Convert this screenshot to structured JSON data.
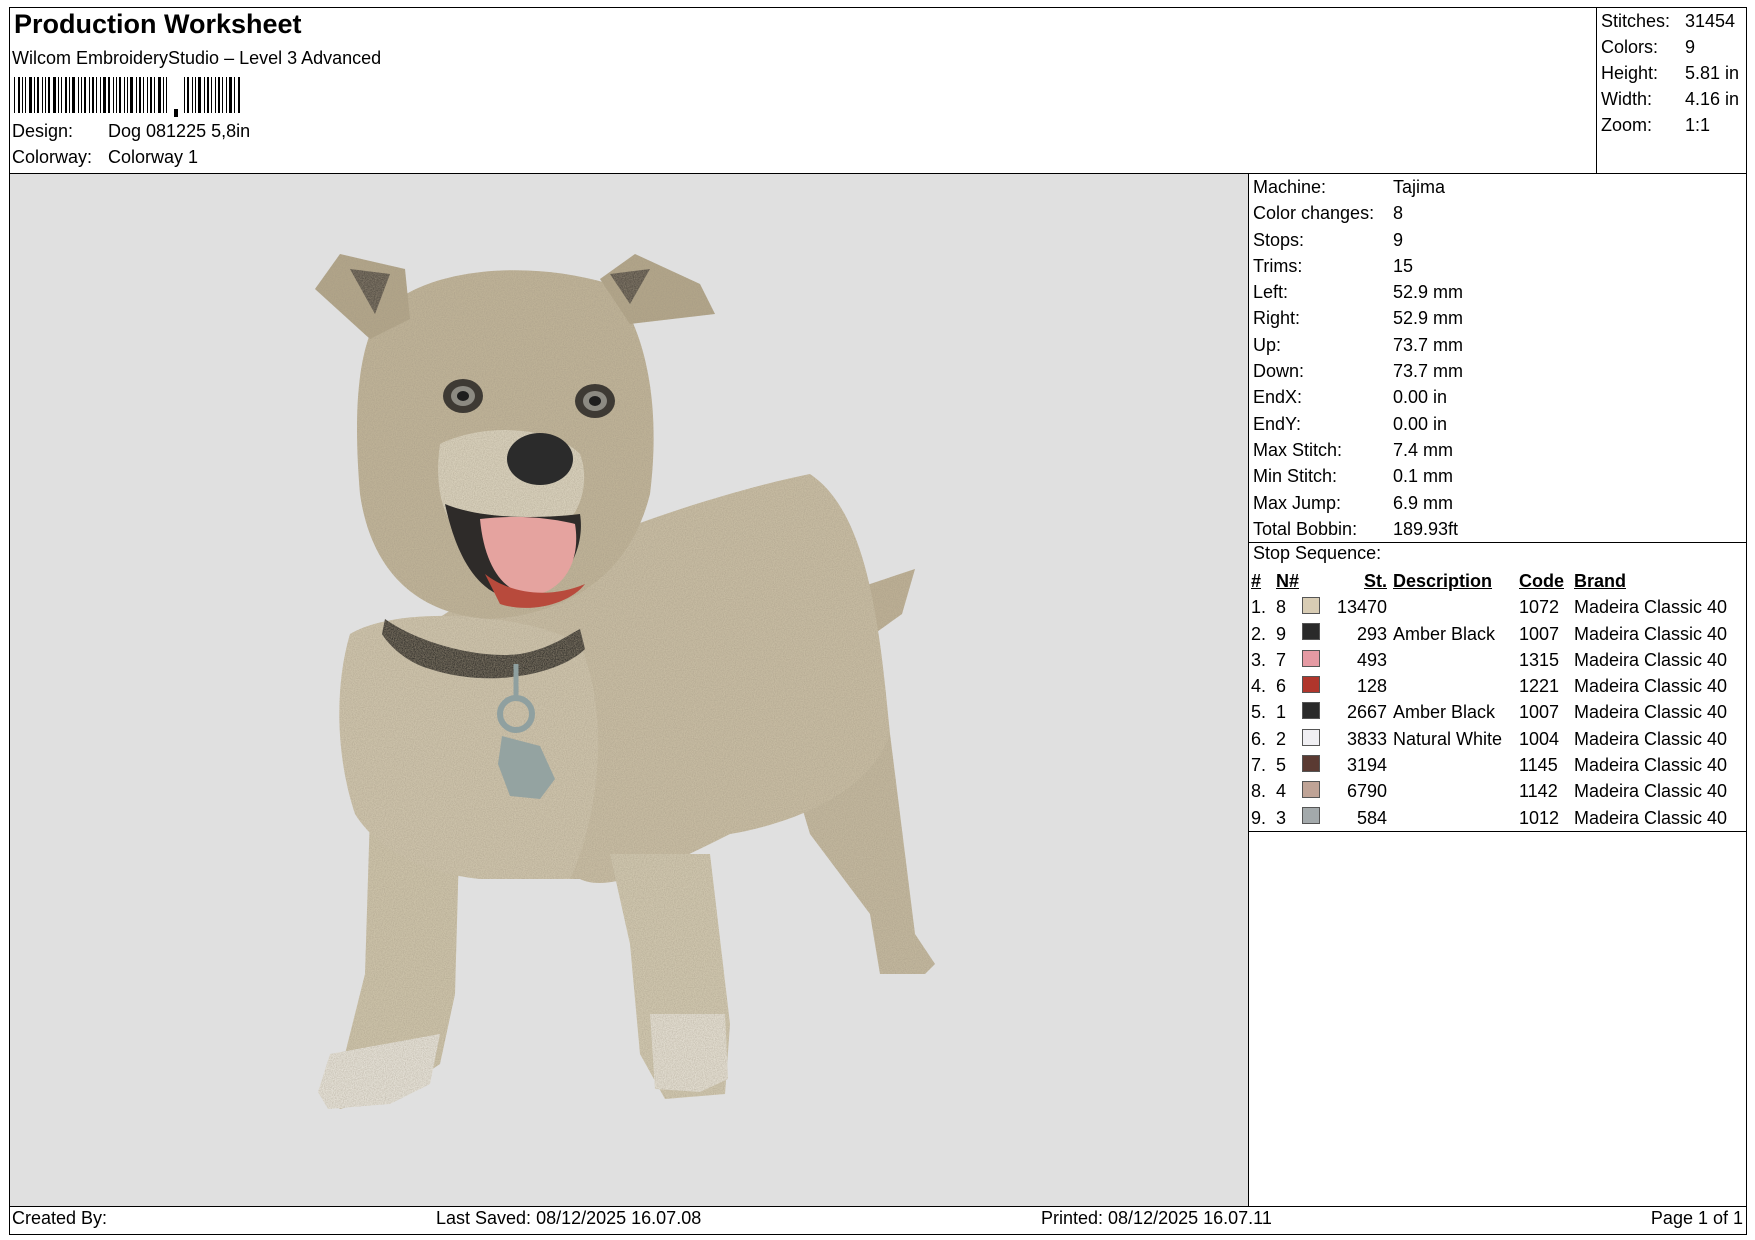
{
  "header": {
    "title": "Production Worksheet",
    "software": "Wilcom EmbroideryStudio – Level 3 Advanced",
    "design_label": "Design:",
    "design_value": "Dog 081225 5,8in",
    "colorway_label": "Colorway:",
    "colorway_value": "Colorway 1"
  },
  "summary": {
    "stitches_label": "Stitches:",
    "stitches": "31454",
    "colors_label": "Colors:",
    "colors": "9",
    "height_label": "Height:",
    "height": "5.81 in",
    "width_label": "Width:",
    "width": "4.16 in",
    "zoom_label": "Zoom:",
    "zoom": "1:1"
  },
  "machine": [
    {
      "label": "Machine:",
      "value": "Tajima"
    },
    {
      "label": "Color changes:",
      "value": "8"
    },
    {
      "label": "Stops:",
      "value": "9"
    },
    {
      "label": "Trims:",
      "value": "15"
    },
    {
      "label": "Left:",
      "value": "52.9 mm"
    },
    {
      "label": "Right:",
      "value": "52.9 mm"
    },
    {
      "label": "Up:",
      "value": "73.7 mm"
    },
    {
      "label": "Down:",
      "value": "73.7 mm"
    },
    {
      "label": "EndX:",
      "value": "0.00 in"
    },
    {
      "label": "EndY:",
      "value": "0.00 in"
    },
    {
      "label": "Max Stitch:",
      "value": "7.4 mm"
    },
    {
      "label": "Min Stitch:",
      "value": "0.1 mm"
    },
    {
      "label": "Max Jump:",
      "value": "6.9 mm"
    },
    {
      "label": "Total Bobbin:",
      "value": "189.93ft"
    }
  ],
  "stop_sequence": {
    "title": "Stop Sequence:",
    "headers": {
      "num": "#",
      "n": "N#",
      "st": "St.",
      "desc": "Description",
      "code": "Code",
      "brand": "Brand"
    },
    "rows": [
      {
        "num": "1.",
        "n": "8",
        "color": "#d8ccb4",
        "st": "13470",
        "desc": "",
        "code": "1072",
        "brand": "Madeira Classic 40"
      },
      {
        "num": "2.",
        "n": "9",
        "color": "#2a2a2a",
        "st": "293",
        "desc": "Amber Black",
        "code": "1007",
        "brand": "Madeira Classic 40"
      },
      {
        "num": "3.",
        "n": "7",
        "color": "#e59aa3",
        "st": "493",
        "desc": "",
        "code": "1315",
        "brand": "Madeira Classic 40"
      },
      {
        "num": "4.",
        "n": "6",
        "color": "#b0362c",
        "st": "128",
        "desc": "",
        "code": "1221",
        "brand": "Madeira Classic 40"
      },
      {
        "num": "5.",
        "n": "1",
        "color": "#2a2a2a",
        "st": "2667",
        "desc": "Amber Black",
        "code": "1007",
        "brand": "Madeira Classic 40"
      },
      {
        "num": "6.",
        "n": "2",
        "color": "#f0eff3",
        "st": "3833",
        "desc": "Natural White",
        "code": "1004",
        "brand": "Madeira Classic 40"
      },
      {
        "num": "7.",
        "n": "5",
        "color": "#5a3a32",
        "st": "3194",
        "desc": "",
        "code": "1145",
        "brand": "Madeira Classic 40"
      },
      {
        "num": "8.",
        "n": "4",
        "color": "#bfa396",
        "st": "6790",
        "desc": "",
        "code": "1142",
        "brand": "Madeira Classic 40"
      },
      {
        "num": "9.",
        "n": "3",
        "color": "#a3a9ab",
        "st": "584",
        "desc": "",
        "code": "1012",
        "brand": "Madeira Classic 40"
      }
    ]
  },
  "footer": {
    "created_by": "Created By:",
    "last_saved": "Last Saved: 08/12/2025 16.07.08",
    "printed": "Printed: 08/12/2025 16.07.11",
    "page": "Page 1 of 1"
  }
}
